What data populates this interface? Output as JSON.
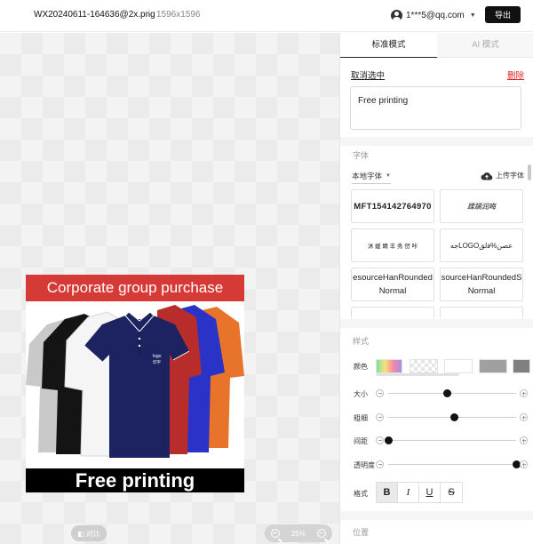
{
  "topbar": {
    "filename": "WX20240611-164636@2x.png",
    "separator": "/",
    "dimensions": "1596x1596",
    "account_email": "1***5@qq.com",
    "export_label": "导出"
  },
  "canvas": {
    "artwork": {
      "banner_text": "Corporate group purchase",
      "logo_text": "logo",
      "logo_subtext": "印字",
      "footer_text": "Free printing"
    },
    "compare_label": "对比",
    "zoom_level": "25%"
  },
  "panel": {
    "tabs": [
      {
        "label": "标准模式",
        "active": true
      },
      {
        "label": "AI 模式",
        "active": false
      }
    ],
    "deselect_label": "取消选中",
    "delete_label": "删除",
    "text_value": "Free printing",
    "font_section_label": "字体",
    "font_source": "本地字体",
    "upload_font_label": "上传字体",
    "font_tiles": [
      {
        "label": "MFT154142764970"
      },
      {
        "label": "蹂躏润晦"
      },
      {
        "label": "沐 媛 睛 丰 秀 哿 咔"
      },
      {
        "label": "ﺟﻪLOGOﻋﺼﻦ%ﻓﻟﻖ"
      },
      {
        "label": "esourceHanRounded Normal"
      },
      {
        "label": "sourceHanRoundedS Normal"
      }
    ],
    "style_section_label": "样式",
    "color_label": "颜色",
    "color_swatches": [
      "#ffffff",
      "#a0a0a0",
      "#808080"
    ],
    "size_label": "大小",
    "size_value": 0.46,
    "weight_label": "粗细",
    "weight_value": 0.52,
    "spacing_label": "间距",
    "spacing_value": 0.0,
    "opacity_label": "透明度",
    "opacity_value": 1.0,
    "format_label": "格式",
    "format_buttons": [
      {
        "label": "B",
        "active": true
      },
      {
        "label": "I",
        "active": false
      },
      {
        "label": "U",
        "active": false
      },
      {
        "label": "S",
        "active": false
      }
    ],
    "position_section_label": "位置"
  }
}
